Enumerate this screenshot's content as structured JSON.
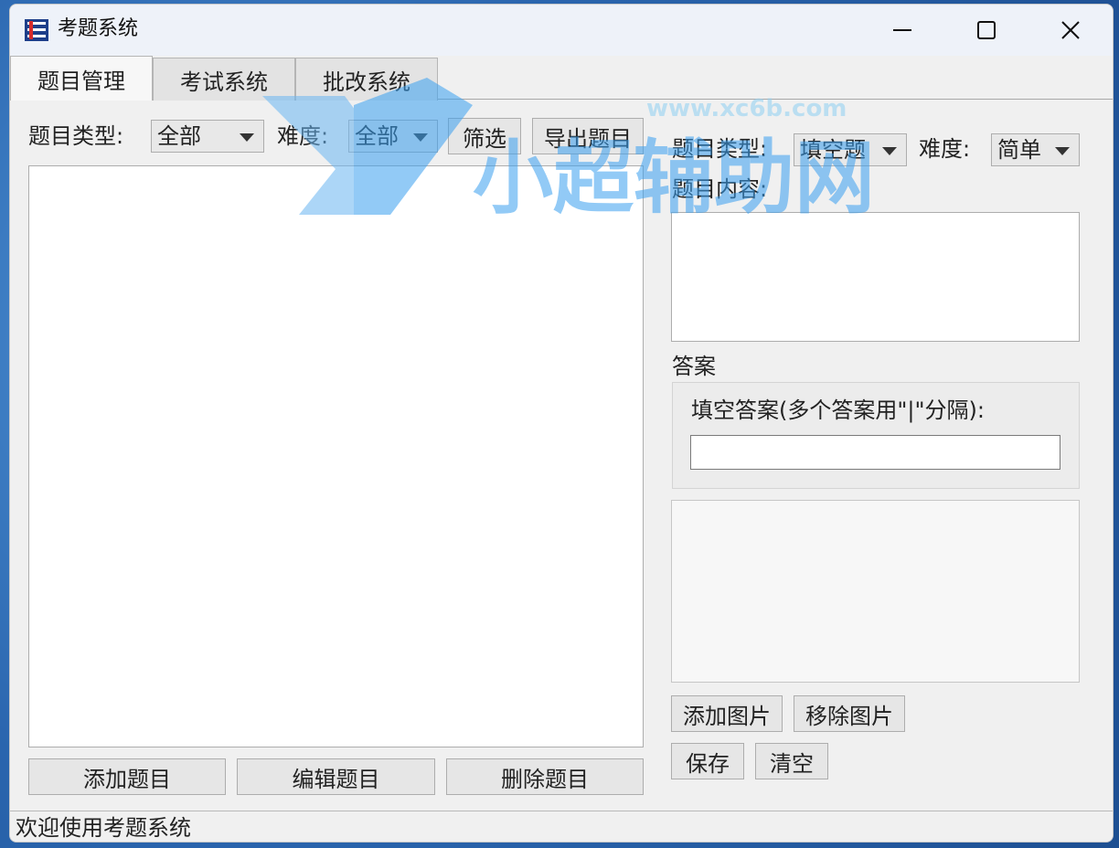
{
  "window": {
    "title": "考题系统",
    "controls": [
      "minimize-icon",
      "maximize-icon",
      "close-icon"
    ]
  },
  "tabs": [
    {
      "label": "题目管理",
      "active": true
    },
    {
      "label": "考试系统",
      "active": false
    },
    {
      "label": "批改系统",
      "active": false
    }
  ],
  "filter": {
    "type_label": "题目类型:",
    "type_value": "全部",
    "difficulty_label": "难度:",
    "difficulty_value": "全部",
    "filter_button": "筛选",
    "export_button": "导出题目"
  },
  "list_actions": {
    "add": "添加题目",
    "edit": "编辑题目",
    "delete": "删除题目"
  },
  "editor": {
    "type_label": "题目类型:",
    "type_value": "填空题",
    "difficulty_label": "难度:",
    "difficulty_value": "简单",
    "content_label": "题目内容:",
    "answer_label": "答案",
    "fill_answer_label": "填空答案(多个答案用\"|\"分隔):",
    "fill_answer_value": "",
    "add_image": "添加图片",
    "remove_image": "移除图片",
    "save": "保存",
    "clear": "清空"
  },
  "status": {
    "text": "欢迎使用考题系统"
  },
  "watermark": {
    "text": "小超辅助网",
    "url": "www.xc6b.com"
  },
  "colors": {
    "watermark_blue": "#3aa0f0",
    "window_bg": "#f0f0f0",
    "titlebar_bg": "#eef2f9"
  }
}
